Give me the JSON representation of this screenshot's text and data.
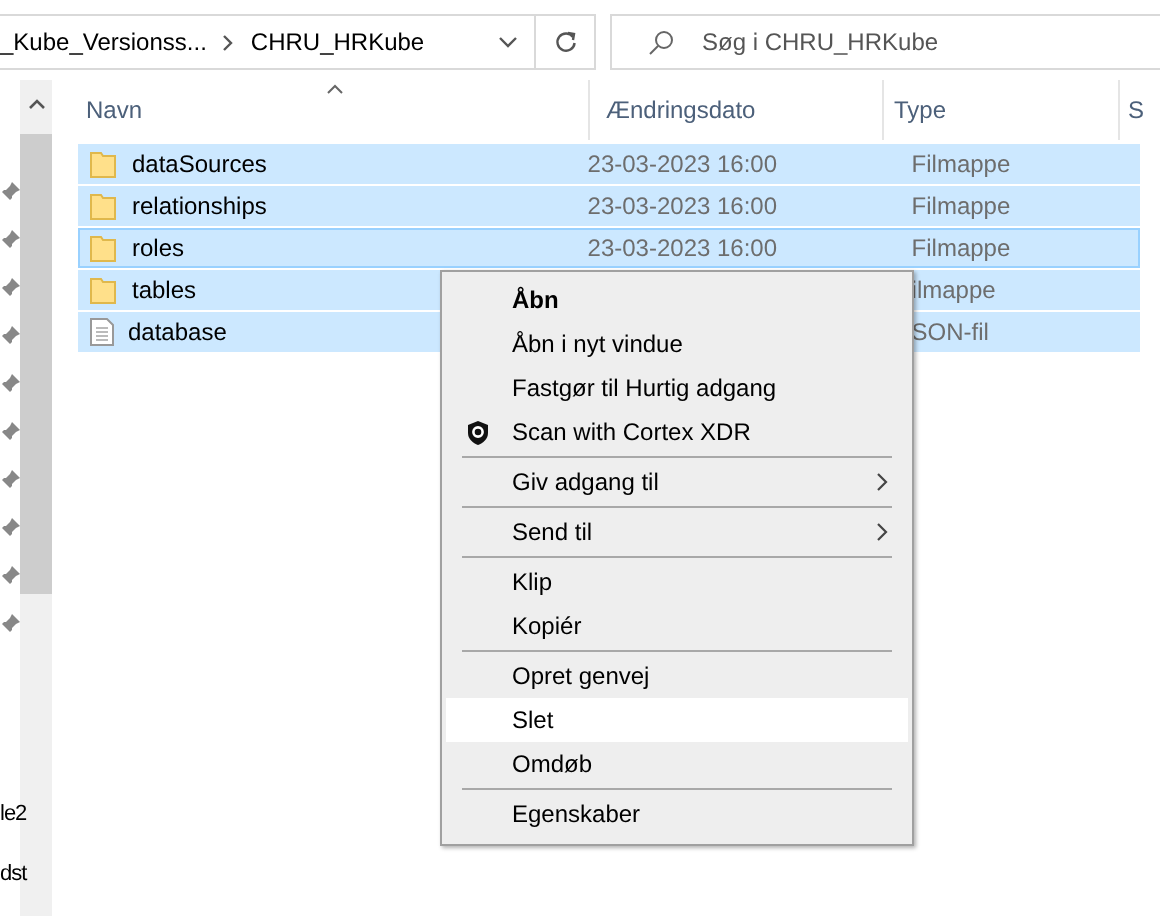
{
  "address_bar": {
    "crumbs": [
      "_Kube_Versionss...",
      "CHRU_HRKube"
    ]
  },
  "search": {
    "placeholder": "Søg i CHRU_HRKube"
  },
  "columns": [
    "Navn",
    "Ændringsdato",
    "Type",
    "S"
  ],
  "sidebar": {
    "items": [
      "le2",
      "dst"
    ]
  },
  "rows": [
    {
      "kind": "folder",
      "name": "dataSources",
      "date": "23-03-2023 16:00",
      "type": "Filmappe",
      "selected": true,
      "focused": false
    },
    {
      "kind": "folder",
      "name": "relationships",
      "date": "23-03-2023 16:00",
      "type": "Filmappe",
      "selected": true,
      "focused": false
    },
    {
      "kind": "folder",
      "name": "roles",
      "date": "23-03-2023 16:00",
      "type": "Filmappe",
      "selected": true,
      "focused": true
    },
    {
      "kind": "folder",
      "name": "tables",
      "type": "ilmappe",
      "selected": true,
      "focused": false
    },
    {
      "kind": "file",
      "name": "database",
      "type": "SON-fil",
      "selected": true,
      "focused": false
    }
  ],
  "context_menu": {
    "groups": [
      [
        {
          "label": "Åbn",
          "bold": true
        },
        {
          "label": "Åbn i nyt vindue"
        },
        {
          "label": "Fastgør til Hurtig adgang"
        },
        {
          "label": "Scan with Cortex XDR",
          "kind": "scan"
        }
      ],
      [
        {
          "label": "Giv adgang til",
          "submenu": true
        }
      ],
      [
        {
          "label": "Send til",
          "submenu": true
        }
      ],
      [
        {
          "label": "Klip"
        },
        {
          "label": "Kopiér"
        }
      ],
      [
        {
          "label": "Opret genvej"
        },
        {
          "label": "Slet",
          "selected": true
        },
        {
          "label": "Omdøb"
        }
      ],
      [
        {
          "label": "Egenskaber"
        }
      ]
    ]
  }
}
